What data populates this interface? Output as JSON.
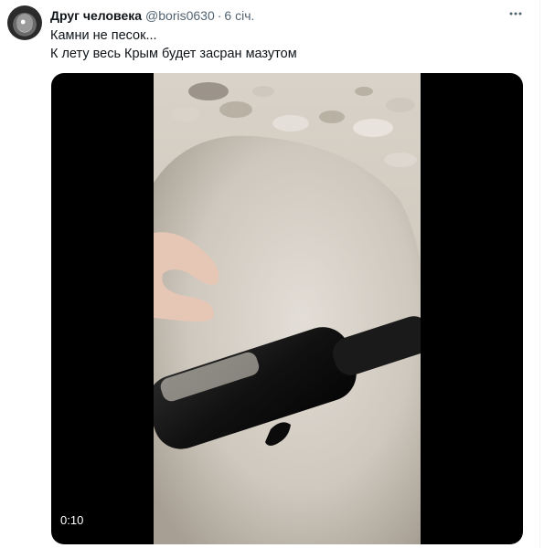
{
  "tweet": {
    "author_name": "Друг человека",
    "author_handle": "@boris0630",
    "separator": "·",
    "time": "6 січ.",
    "more_icon": "more-horizontal-icon",
    "text_lines": [
      "Камни не песок...",
      "К лету весь Крым будет засран мазутом"
    ]
  },
  "media": {
    "type": "video",
    "timestamp": "0:10"
  }
}
